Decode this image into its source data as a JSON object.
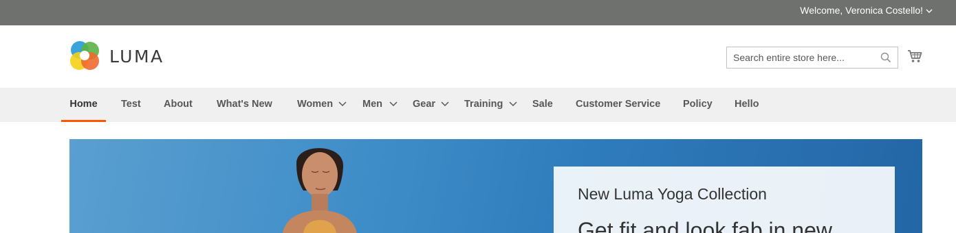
{
  "topbar": {
    "welcome_text": "Welcome, Veronica Costello!"
  },
  "header": {
    "logo_text": "LUMA",
    "search_placeholder": "Search entire store here..."
  },
  "nav": {
    "items": [
      {
        "label": "Home",
        "active": true
      },
      {
        "label": "Test"
      },
      {
        "label": "About"
      },
      {
        "label": "What's New"
      },
      {
        "label": "Women",
        "dropdown": true
      },
      {
        "label": "Men",
        "dropdown": true
      },
      {
        "label": "Gear",
        "dropdown": true
      },
      {
        "label": "Training",
        "dropdown": true
      },
      {
        "label": "Sale"
      },
      {
        "label": "Customer Service"
      },
      {
        "label": "Policy"
      },
      {
        "label": "Hello"
      }
    ]
  },
  "banner": {
    "title": "New Luma Yoga Collection",
    "subtitle": "Get fit and look fab in new"
  },
  "colors": {
    "topbar": "#6e716e",
    "nav_bg": "#f0f0f0",
    "active_underline": "#ff5501"
  }
}
